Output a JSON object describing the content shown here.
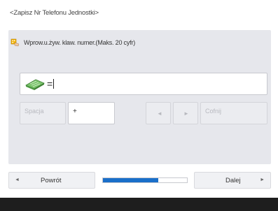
{
  "screen": {
    "title": "<Zapisz Nr Telefonu Jednostki>"
  },
  "instruction": {
    "text": "Wprow.u.żyw. klaw. numer.(Maks. 20 cyfr)",
    "icon": "hand-keypad-icon"
  },
  "input": {
    "icon": "keyboard-icon",
    "value": "="
  },
  "keys": {
    "space_label": "Spacja",
    "plus_label": "+",
    "left_arrow": "◄",
    "right_arrow": "►",
    "back_label": "Cofnij"
  },
  "navigation": {
    "back_label": "Powrót",
    "back_arrow": "◄",
    "next_label": "Dalej",
    "next_arrow": "►",
    "progress": 0.66
  },
  "colors": {
    "accent": "#1a6fc9",
    "panel": "#e6e7ec",
    "footer": "#1e1e1e"
  }
}
